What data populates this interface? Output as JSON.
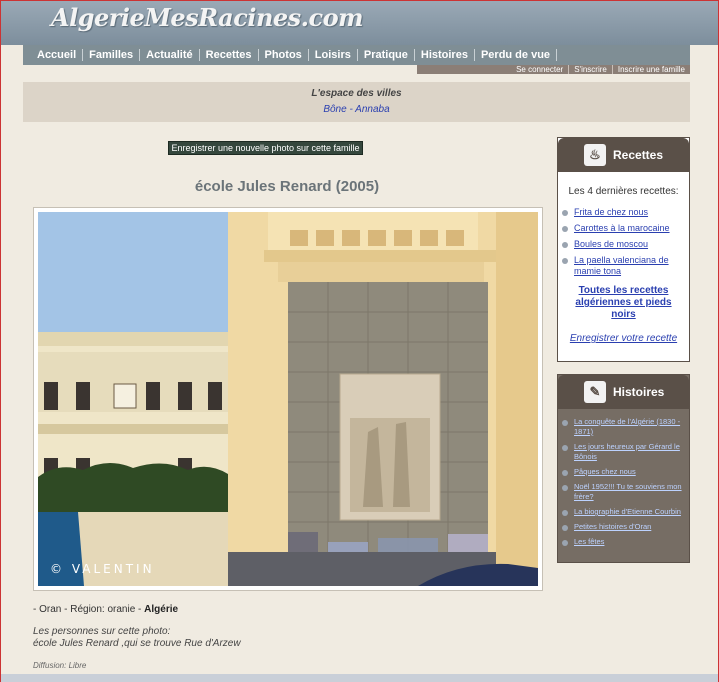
{
  "site": {
    "logo": "AlgerieMesRacines.com"
  },
  "nav": {
    "items": [
      "Accueil",
      "Familles",
      "Actualité",
      "Recettes",
      "Photos",
      "Loisirs",
      "Pratique",
      "Histoires",
      "Perdu de vue"
    ],
    "account": [
      "Se connecter",
      "S'inscrire",
      "Inscrire une famille"
    ]
  },
  "villes": {
    "title": "L'espace des villes",
    "link": "Bône - Annaba"
  },
  "photo": {
    "button": "Enregistrer une nouvelle photo sur cette famille",
    "title": "école Jules Renard (2005)",
    "watermark": "© VALENTIN",
    "location_prefix": "- Oran - Région: oranie - ",
    "country": "Algérie",
    "persons_label": "Les personnes sur cette photo:",
    "persons_text": "école Jules Renard ,qui se trouve Rue d'Arzew",
    "diffusion": "Diffusion: Libre"
  },
  "recettes": {
    "title": "Recettes",
    "intro": "Les 4 dernières recettes:",
    "items": [
      "Frita de chez nous",
      "Carottes à la marocaine",
      "Boules de moscou",
      "La paella valenciana de mamie tona"
    ],
    "all_link": "Toutes les recettes algériennes et pieds noirs",
    "save_link": "Enregistrer votre recette"
  },
  "histoires": {
    "title": "Histoires",
    "items": [
      "La conquête de l'Algérie (1830 - 1871)",
      "Les jours heureux par Gérard le Bônois",
      "Pâques chez nous",
      "Noël 1952!!! Tu te souviens mon frère?",
      "La biographie d'Etienne Courbin",
      "Petites histoires d'Oran",
      "Les fêtes"
    ]
  }
}
